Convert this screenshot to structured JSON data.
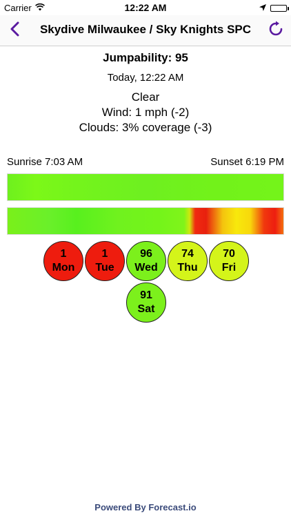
{
  "status_bar": {
    "carrier": "Carrier",
    "time": "12:22 AM"
  },
  "nav": {
    "title": "Skydive Milwaukee / Sky Knights SPC",
    "accent_color": "#5a1aa0"
  },
  "summary": {
    "jumpability": "Jumpability: 95",
    "timestamp": "Today, 12:22 AM",
    "condition": "Clear",
    "wind": "Wind: 1 mph (-2)",
    "clouds": "Clouds: 3% coverage (-3)"
  },
  "sun": {
    "sunrise": "Sunrise 7:03 AM",
    "sunset": "Sunset 6:19 PM"
  },
  "days": [
    {
      "score": "1",
      "label": "Mon",
      "color": "#ee1c0e"
    },
    {
      "score": "1",
      "label": "Tue",
      "color": "#ee1c0e"
    },
    {
      "score": "96",
      "label": "Wed",
      "color": "#7cf01c"
    },
    {
      "score": "74",
      "label": "Thu",
      "color": "#d4f41a"
    },
    {
      "score": "70",
      "label": "Fri",
      "color": "#d4f41a"
    },
    {
      "score": "91",
      "label": "Sat",
      "color": "#7cf01c"
    }
  ],
  "footer": {
    "credit": "Powered By Forecast.io"
  }
}
